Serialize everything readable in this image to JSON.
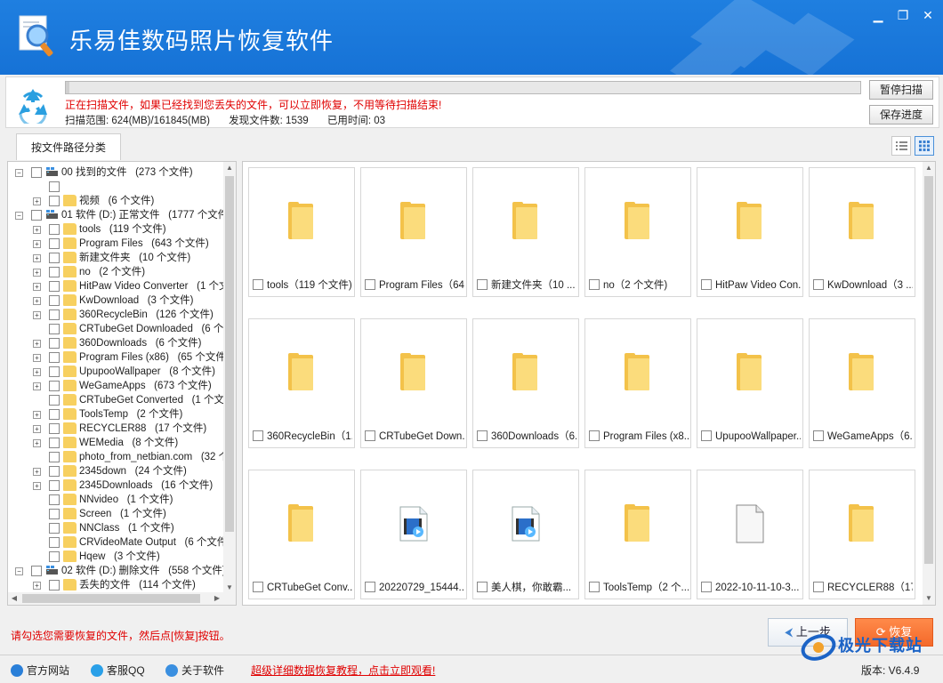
{
  "app": {
    "title": "乐易佳数码照片恢复软件",
    "accent": "#1672d6",
    "window_controls": {
      "minimize": "▁",
      "restore": "❐",
      "close": "✕"
    }
  },
  "scan": {
    "progress_percent": 0.4,
    "message": "正在扫描文件，如果已经找到您丢失的文件，可以立即恢复，不用等待扫描结束!",
    "range": "扫描范围: 624(MB)/161845(MB)",
    "found": "发现文件数: 1539",
    "elapsed": "已用时间: 03",
    "pause_label": "暂停扫描",
    "save_label": "保存进度"
  },
  "tabs": [
    {
      "label": "按文件路径分类"
    }
  ],
  "tree": {
    "items": [
      {
        "label": "00 找到的文件",
        "count": "(273 个文件)",
        "level": 0,
        "type": "drive",
        "expander": "−"
      },
      {
        "label": "",
        "count": "",
        "level": 1,
        "type": "blank",
        "expander": ""
      },
      {
        "label": "视频",
        "count": "(6 个文件)",
        "level": 1,
        "type": "folder",
        "expander": "+"
      },
      {
        "label": "01 软件 (D:) 正常文件",
        "count": "(1777 个文件)",
        "level": 0,
        "type": "drive",
        "expander": "−"
      },
      {
        "label": "tools",
        "count": "(119 个文件)",
        "level": 1,
        "type": "folder",
        "expander": "+"
      },
      {
        "label": "Program Files",
        "count": "(643 个文件)",
        "level": 1,
        "type": "folder",
        "expander": "+"
      },
      {
        "label": "新建文件夹",
        "count": "(10 个文件)",
        "level": 1,
        "type": "folder",
        "expander": "+"
      },
      {
        "label": "no",
        "count": "(2 个文件)",
        "level": 1,
        "type": "folder",
        "expander": "+"
      },
      {
        "label": "HitPaw Video Converter",
        "count": "(1 个文件)",
        "level": 1,
        "type": "folder",
        "expander": "+"
      },
      {
        "label": "KwDownload",
        "count": "(3 个文件)",
        "level": 1,
        "type": "folder",
        "expander": "+"
      },
      {
        "label": "360RecycleBin",
        "count": "(126 个文件)",
        "level": 1,
        "type": "folder",
        "expander": "+"
      },
      {
        "label": "CRTubeGet Downloaded",
        "count": "(6 个文件)",
        "level": 1,
        "type": "folder",
        "expander": ""
      },
      {
        "label": "360Downloads",
        "count": "(6 个文件)",
        "level": 1,
        "type": "folder",
        "expander": "+"
      },
      {
        "label": "Program Files (x86)",
        "count": "(65 个文件)",
        "level": 1,
        "type": "folder",
        "expander": "+"
      },
      {
        "label": "UpupooWallpaper",
        "count": "(8 个文件)",
        "level": 1,
        "type": "folder",
        "expander": "+"
      },
      {
        "label": "WeGameApps",
        "count": "(673 个文件)",
        "level": 1,
        "type": "folder",
        "expander": "+"
      },
      {
        "label": "CRTubeGet Converted",
        "count": "(1 个文件)",
        "level": 1,
        "type": "folder",
        "expander": ""
      },
      {
        "label": "ToolsTemp",
        "count": "(2 个文件)",
        "level": 1,
        "type": "folder",
        "expander": "+"
      },
      {
        "label": "RECYCLER88",
        "count": "(17 个文件)",
        "level": 1,
        "type": "folder",
        "expander": "+"
      },
      {
        "label": "WEMedia",
        "count": "(8 个文件)",
        "level": 1,
        "type": "folder",
        "expander": "+"
      },
      {
        "label": "photo_from_netbian.com",
        "count": "(32 个文件)",
        "level": 1,
        "type": "folder",
        "expander": ""
      },
      {
        "label": "2345down",
        "count": "(24 个文件)",
        "level": 1,
        "type": "folder",
        "expander": "+"
      },
      {
        "label": "2345Downloads",
        "count": "(16 个文件)",
        "level": 1,
        "type": "folder",
        "expander": "+"
      },
      {
        "label": "NNvideo",
        "count": "(1 个文件)",
        "level": 1,
        "type": "folder",
        "expander": ""
      },
      {
        "label": "Screen",
        "count": "(1 个文件)",
        "level": 1,
        "type": "folder",
        "expander": ""
      },
      {
        "label": "NNClass",
        "count": "(1 个文件)",
        "level": 1,
        "type": "folder",
        "expander": ""
      },
      {
        "label": "CRVideoMate Output",
        "count": "(6 个文件)",
        "level": 1,
        "type": "folder",
        "expander": ""
      },
      {
        "label": "Hqew",
        "count": "(3 个文件)",
        "level": 1,
        "type": "folder",
        "expander": ""
      },
      {
        "label": "02 软件 (D:) 删除文件",
        "count": "(558 个文件)",
        "level": 0,
        "type": "drive",
        "expander": "−"
      },
      {
        "label": "丢失的文件",
        "count": "(114 个文件)",
        "level": 1,
        "type": "folder",
        "expander": "+"
      }
    ]
  },
  "grid": {
    "items": [
      {
        "label": "tools（119 个文件)",
        "kind": "folder"
      },
      {
        "label": "Program Files（64...",
        "kind": "folder"
      },
      {
        "label": "新建文件夹（10 ...",
        "kind": "folder"
      },
      {
        "label": "no（2 个文件)",
        "kind": "folder"
      },
      {
        "label": "HitPaw Video Con...",
        "kind": "folder"
      },
      {
        "label": "KwDownload（3 ...",
        "kind": "folder"
      },
      {
        "label": "360RecycleBin（1...",
        "kind": "folder"
      },
      {
        "label": "CRTubeGet Down...",
        "kind": "folder"
      },
      {
        "label": "360Downloads（6...",
        "kind": "folder"
      },
      {
        "label": "Program Files (x8...",
        "kind": "folder"
      },
      {
        "label": "UpupooWallpaper...",
        "kind": "folder"
      },
      {
        "label": "WeGameApps（6...",
        "kind": "folder"
      },
      {
        "label": "CRTubeGet Conv...",
        "kind": "folder"
      },
      {
        "label": "20220729_15444...",
        "kind": "video"
      },
      {
        "label": "美人棋，你敢霸...",
        "kind": "video"
      },
      {
        "label": "ToolsTemp（2 个...",
        "kind": "folder"
      },
      {
        "label": "2022-10-11-10-3...",
        "kind": "file"
      },
      {
        "label": "RECYCLER88（17...",
        "kind": "folder"
      }
    ]
  },
  "bottom": {
    "hint": "请勾选您需要恢复的文件，然后点[恢复]按钮。",
    "prev_label": "上一步",
    "recover_label": "恢复"
  },
  "footer": {
    "website": "官方网站",
    "qq": "客服QQ",
    "about": "关于软件",
    "promo": "超级详细数据恢复教程，点击立即观看!",
    "version": "版本: V6.4.9"
  },
  "watermark": {
    "text": "极光下载站"
  }
}
